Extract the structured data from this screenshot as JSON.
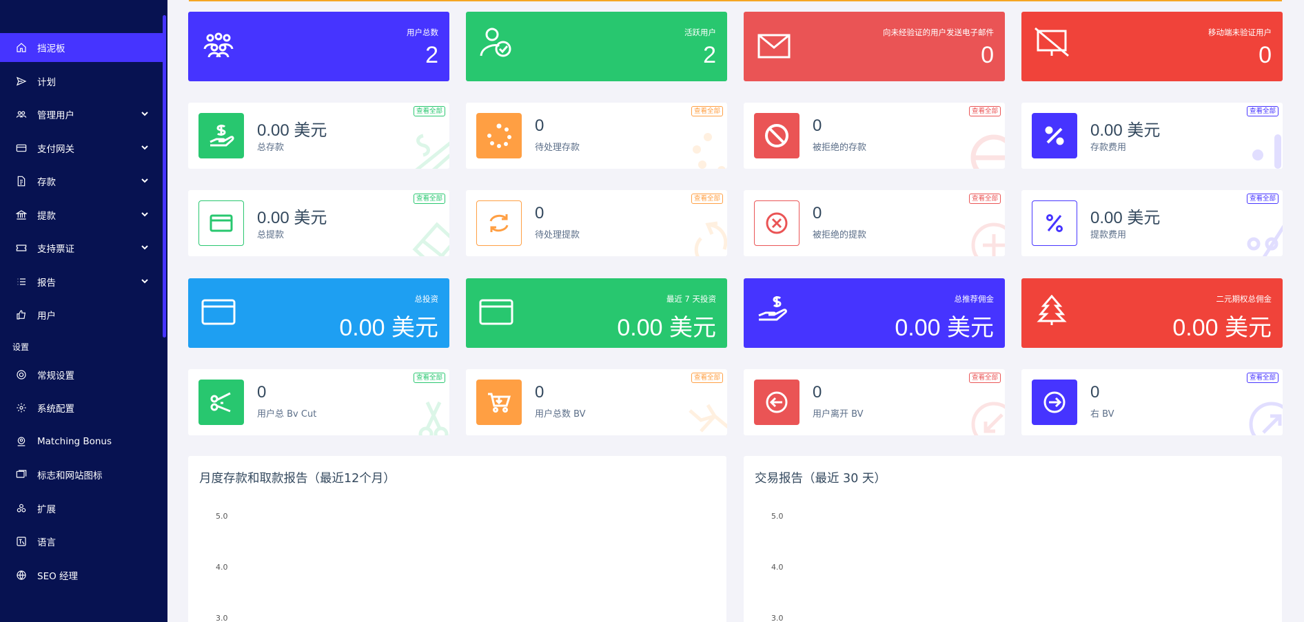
{
  "colors": {
    "sidebar": "#071251",
    "primary": "#4634ff",
    "success": "#28c76f",
    "danger": "#ea5455",
    "red": "#f0433a",
    "warning": "#ff9f43",
    "info": "#1e9ff2",
    "accent_line": "#f5a623"
  },
  "sidebar": {
    "items": [
      {
        "label": "挡泥板",
        "icon": "home-icon",
        "active": true,
        "has_children": false
      },
      {
        "label": "计划",
        "icon": "send-icon",
        "active": false,
        "has_children": false
      },
      {
        "label": "管理用户",
        "icon": "users-icon",
        "active": false,
        "has_children": true
      },
      {
        "label": "支付网关",
        "icon": "credit-card-icon",
        "active": false,
        "has_children": true
      },
      {
        "label": "存款",
        "icon": "file-money-icon",
        "active": false,
        "has_children": true
      },
      {
        "label": "提款",
        "icon": "bank-icon",
        "active": false,
        "has_children": true
      },
      {
        "label": "支持票证",
        "icon": "ticket-icon",
        "active": false,
        "has_children": true
      },
      {
        "label": "报告",
        "icon": "list-icon",
        "active": false,
        "has_children": true
      },
      {
        "label": "用户",
        "icon": "thumbs-up-icon",
        "active": false,
        "has_children": false
      }
    ],
    "section_label": "设置",
    "settings_items": [
      {
        "label": "常规设置",
        "icon": "life-ring-icon"
      },
      {
        "label": "系统配置",
        "icon": "cog-icon"
      },
      {
        "label": "Matching Bonus",
        "icon": "user-badge-icon"
      },
      {
        "label": "标志和网站图标",
        "icon": "images-icon"
      },
      {
        "label": "扩展",
        "icon": "cogs-icon"
      },
      {
        "label": "语言",
        "icon": "language-icon"
      },
      {
        "label": "SEO 经理",
        "icon": "globe-icon"
      }
    ]
  },
  "top_widgets": [
    {
      "label": "用户总数",
      "value": "2",
      "icon": "users-group-icon",
      "color": "#4634ff"
    },
    {
      "label": "活跃用户",
      "value": "2",
      "icon": "user-check-icon",
      "color": "#28c76f"
    },
    {
      "label": "向未经验证的用户发送电子邮件",
      "value": "0",
      "icon": "envelope-icon",
      "color": "#ea5455"
    },
    {
      "label": "移动端未验证用户",
      "value": "0",
      "icon": "mobile-slash-icon",
      "color": "#f0433a"
    }
  ],
  "deposit_cards": [
    {
      "value": "0.00 美元",
      "label": "总存款",
      "link": "查看全部",
      "icon": "hand-dollar-icon",
      "color": "#28c76f"
    },
    {
      "value": "0",
      "label": "待处理存款",
      "link": "查看全部",
      "icon": "spinner-icon",
      "color": "#ff9f43"
    },
    {
      "value": "0",
      "label": "被拒绝的存款",
      "link": "查看全部",
      "icon": "ban-icon",
      "color": "#ea5455"
    },
    {
      "value": "0.00 美元",
      "label": "存款费用",
      "link": "查看全部",
      "icon": "percent-icon",
      "color": "#4634ff"
    }
  ],
  "withdraw_cards": [
    {
      "value": "0.00 美元",
      "label": "总提款",
      "link": "查看全部",
      "icon": "card-icon",
      "color": "#28c76f"
    },
    {
      "value": "0",
      "label": "待处理提款",
      "link": "查看全部",
      "icon": "sync-icon",
      "color": "#ff9f43"
    },
    {
      "value": "0",
      "label": "被拒绝的提款",
      "link": "查看全部",
      "icon": "times-circle-icon",
      "color": "#ea5455"
    },
    {
      "value": "0.00 美元",
      "label": "提款费用",
      "link": "查看全部",
      "icon": "percent-icon",
      "color": "#4634ff"
    }
  ],
  "money_widgets": [
    {
      "label": "总投资",
      "value": "0.00 美元",
      "icon": "card-icon",
      "color": "#1e9ff2"
    },
    {
      "label": "最近 7 天投资",
      "value": "0.00 美元",
      "icon": "card-icon",
      "color": "#28c76f"
    },
    {
      "label": "总推荐佣金",
      "value": "0.00 美元",
      "icon": "hand-dollar-icon",
      "color": "#4634ff"
    },
    {
      "label": "二元期权总佣金",
      "value": "0.00 美元",
      "icon": "tree-icon",
      "color": "#f0433a"
    }
  ],
  "bv_cards": [
    {
      "value": "0",
      "label": "用户总 Bv Cut",
      "link": "查看全部",
      "icon": "scissors-icon",
      "color": "#28c76f"
    },
    {
      "value": "0",
      "label": "用户总数 BV",
      "link": "查看全部",
      "icon": "cart-icon",
      "color": "#ff9f43"
    },
    {
      "value": "0",
      "label": "用户离开 BV",
      "link": "查看全部",
      "icon": "arrow-left-circle-icon",
      "color": "#ea5455"
    },
    {
      "value": "0",
      "label": "右 BV",
      "link": "查看全部",
      "icon": "arrow-right-circle-icon",
      "color": "#4634ff"
    }
  ],
  "panels": [
    {
      "title": "月度存款和取款报告（最近12个月）",
      "ticks": [
        "5.0",
        "4.0",
        "3.0"
      ]
    },
    {
      "title": "交易报告（最近 30 天）",
      "ticks": [
        "5.0",
        "4.0",
        "3.0"
      ]
    }
  ]
}
